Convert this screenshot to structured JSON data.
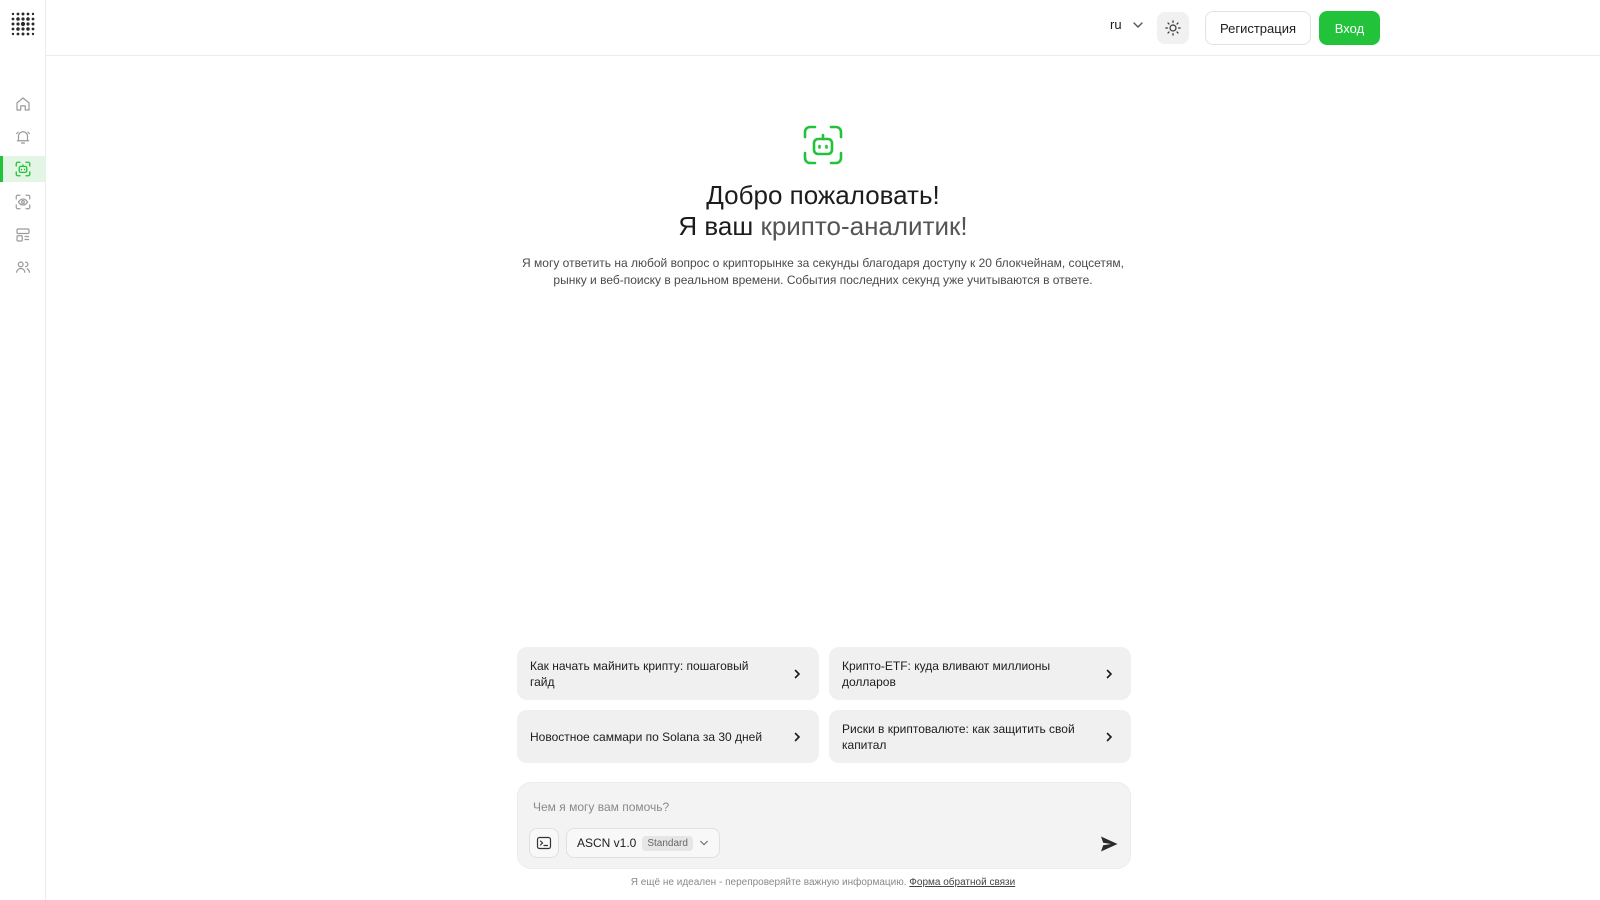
{
  "colors": {
    "accent": "#22c33a",
    "card_bg": "#f0f0f0",
    "text": "#1c1c1c"
  },
  "sidebar": {
    "items": [
      {
        "name": "home",
        "icon": "home-icon",
        "active": false
      },
      {
        "name": "alerts",
        "icon": "bell-icon",
        "active": false
      },
      {
        "name": "ai-analyst",
        "icon": "bot-scan-icon",
        "active": true
      },
      {
        "name": "watch",
        "icon": "eye-scan-icon",
        "active": false
      },
      {
        "name": "dashboards",
        "icon": "layout-icon",
        "active": false
      },
      {
        "name": "community",
        "icon": "users-icon",
        "active": false
      }
    ]
  },
  "header": {
    "language": "ru",
    "register_label": "Регистрация",
    "login_label": "Вход"
  },
  "hero": {
    "title_line1": "Добро пожаловать!",
    "title_line2_prefix": "Я ваш ",
    "title_line2_accent": "крипто-аналитик!",
    "description": "Я могу ответить на любой вопрос о крипторынке за секунды благодаря доступу к 20 блокчейнам, соцсетям, рынку и веб-поиску в реальном времени. События последних секунд уже учитываются в ответе."
  },
  "suggestions": [
    {
      "text": "Как начать майнить крипту: пошаговый гайд"
    },
    {
      "text": "Крипто-ETF: куда вливают миллионы долларов"
    },
    {
      "text": "Новостное саммари по Solana за 30 дней"
    },
    {
      "text": "Риски в криптовалюте: как защитить свой капитал"
    }
  ],
  "composer": {
    "placeholder": "Чем я могу вам помочь?",
    "value": "",
    "model_name": "ASCN v1.0",
    "model_tier": "Standard"
  },
  "footer": {
    "note": "Я ещё не идеален - перепроверяйте важную информацию.",
    "link": "Форма обратной связи"
  }
}
